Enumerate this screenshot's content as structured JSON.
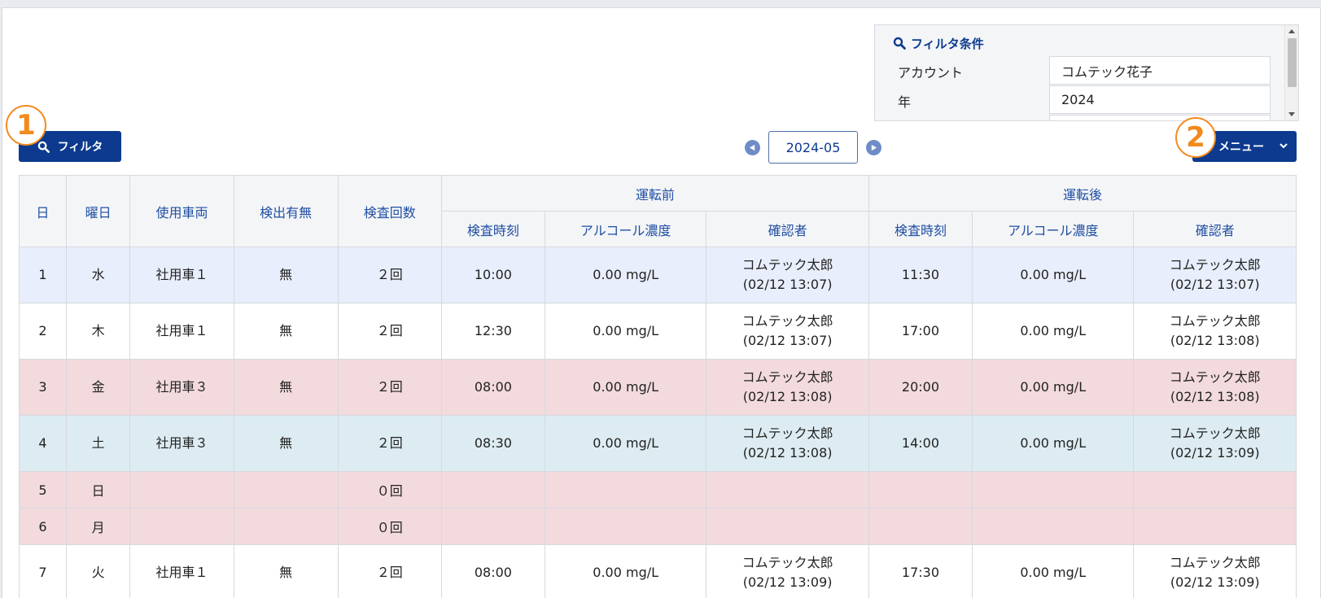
{
  "filter_panel": {
    "title": "フィルタ条件",
    "fields": [
      {
        "label": "アカウント",
        "value": "コムテック花子"
      },
      {
        "label": "年",
        "value": "2024"
      }
    ]
  },
  "toolbar": {
    "filter_button": "フィルタ",
    "menu_button": "メニュー",
    "month": "2024-05",
    "callouts": [
      "1",
      "2"
    ]
  },
  "table": {
    "headers": {
      "day": "日",
      "weekday": "曜日",
      "vehicle": "使用車両",
      "detected": "検出有無",
      "count": "検査回数",
      "before_group": "運転前",
      "after_group": "運転後",
      "sub": [
        "検査時刻",
        "アルコール濃度",
        "確認者",
        "検査時刻",
        "アルコール濃度",
        "確認者"
      ]
    },
    "rows": [
      {
        "day": "1",
        "weekday": "水",
        "vehicle": "社用車１",
        "detected": "無",
        "count": "２回",
        "b_time": "10:00",
        "b_conc": "0.00 mg/L",
        "b_by": "コムテック太郎",
        "b_by_ts": "(02/12 13:07)",
        "a_time": "11:30",
        "a_conc": "0.00 mg/L",
        "a_by": "コムテック太郎",
        "a_by_ts": "(02/12 13:07)"
      },
      {
        "day": "2",
        "weekday": "木",
        "vehicle": "社用車１",
        "detected": "無",
        "count": "２回",
        "b_time": "12:30",
        "b_conc": "0.00 mg/L",
        "b_by": "コムテック太郎",
        "b_by_ts": "(02/12 13:07)",
        "a_time": "17:00",
        "a_conc": "0.00 mg/L",
        "a_by": "コムテック太郎",
        "a_by_ts": "(02/12 13:08)"
      },
      {
        "day": "3",
        "weekday": "金",
        "vehicle": "社用車３",
        "detected": "無",
        "count": "２回",
        "b_time": "08:00",
        "b_conc": "0.00 mg/L",
        "b_by": "コムテック太郎",
        "b_by_ts": "(02/12 13:08)",
        "a_time": "20:00",
        "a_conc": "0.00 mg/L",
        "a_by": "コムテック太郎",
        "a_by_ts": "(02/12 13:08)"
      },
      {
        "day": "4",
        "weekday": "土",
        "vehicle": "社用車３",
        "detected": "無",
        "count": "２回",
        "b_time": "08:30",
        "b_conc": "0.00 mg/L",
        "b_by": "コムテック太郎",
        "b_by_ts": "(02/12 13:08)",
        "a_time": "14:00",
        "a_conc": "0.00 mg/L",
        "a_by": "コムテック太郎",
        "a_by_ts": "(02/12 13:09)"
      },
      {
        "day": "5",
        "weekday": "日",
        "count": "０回"
      },
      {
        "day": "6",
        "weekday": "月",
        "count": "０回"
      },
      {
        "day": "7",
        "weekday": "火",
        "vehicle": "社用車１",
        "detected": "無",
        "count": "２回",
        "b_time": "08:00",
        "b_conc": "0.00 mg/L",
        "b_by": "コムテック太郎",
        "b_by_ts": "(02/12 13:09)",
        "a_time": "17:30",
        "a_conc": "0.00 mg/L",
        "a_by": "コムテック太郎",
        "a_by_ts": "(02/12 13:09)"
      }
    ]
  },
  "colors": {
    "primary": "#0d3a8e",
    "accent_orange": "#f28a1d",
    "row_blue": "#e8eefb",
    "row_pink": "#f2dadd",
    "row_cyan": "#dcecf2"
  }
}
